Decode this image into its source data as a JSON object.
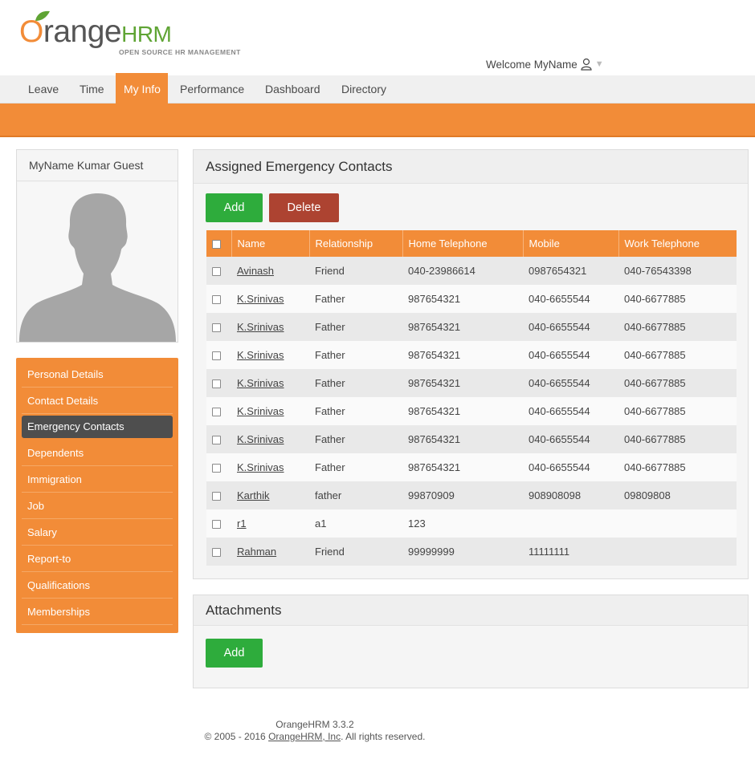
{
  "brand": {
    "logo_o": "O",
    "logo_range": "range",
    "logo_hrm": "HRM",
    "tagline": "OPEN SOURCE HR MANAGEMENT",
    "color_orange": "#f28c38",
    "color_green": "#5fa434"
  },
  "welcome": {
    "text": "Welcome MyName",
    "icon": "user-icon",
    "caret": "▼"
  },
  "nav": {
    "tabs": [
      {
        "label": "Leave"
      },
      {
        "label": "Time"
      },
      {
        "label": "My Info",
        "active": true
      },
      {
        "label": "Performance"
      },
      {
        "label": "Dashboard"
      },
      {
        "label": "Directory"
      }
    ]
  },
  "profile": {
    "name": "MyName Kumar Guest",
    "photo_icon": "profile-silhouette"
  },
  "sidemenu": {
    "items": [
      {
        "label": "Personal Details"
      },
      {
        "label": "Contact Details"
      },
      {
        "label": "Emergency Contacts",
        "active": true
      },
      {
        "label": "Dependents"
      },
      {
        "label": "Immigration"
      },
      {
        "label": "Job"
      },
      {
        "label": "Salary"
      },
      {
        "label": "Report-to"
      },
      {
        "label": "Qualifications"
      },
      {
        "label": "Memberships"
      }
    ]
  },
  "emergency": {
    "title": "Assigned Emergency Contacts",
    "add_label": "Add",
    "delete_label": "Delete",
    "columns": [
      "Name",
      "Relationship",
      "Home Telephone",
      "Mobile",
      "Work Telephone"
    ],
    "rows": [
      [
        "Avinash",
        "Friend",
        "040-23986614",
        "0987654321",
        "040-76543398"
      ],
      [
        "K.Srinivas",
        "Father",
        "987654321",
        "040-6655544",
        "040-6677885"
      ],
      [
        "K.Srinivas",
        "Father",
        "987654321",
        "040-6655544",
        "040-6677885"
      ],
      [
        "K.Srinivas",
        "Father",
        "987654321",
        "040-6655544",
        "040-6677885"
      ],
      [
        "K.Srinivas",
        "Father",
        "987654321",
        "040-6655544",
        "040-6677885"
      ],
      [
        "K.Srinivas",
        "Father",
        "987654321",
        "040-6655544",
        "040-6677885"
      ],
      [
        "K.Srinivas",
        "Father",
        "987654321",
        "040-6655544",
        "040-6677885"
      ],
      [
        "K.Srinivas",
        "Father",
        "987654321",
        "040-6655544",
        "040-6677885"
      ],
      [
        "Karthik",
        "father",
        "99870909",
        "908908098",
        "09809808"
      ],
      [
        "r1",
        "a1",
        "123",
        "",
        ""
      ],
      [
        "Rahman",
        "Friend",
        "99999999",
        "11111111",
        ""
      ]
    ]
  },
  "attachments": {
    "title": "Attachments",
    "add_label": "Add"
  },
  "footer": {
    "version": "OrangeHRM 3.3.2",
    "copyright_prefix": "© 2005 - 2016 ",
    "company_link": "OrangeHRM, Inc",
    "copyright_suffix": ". All rights reserved."
  }
}
